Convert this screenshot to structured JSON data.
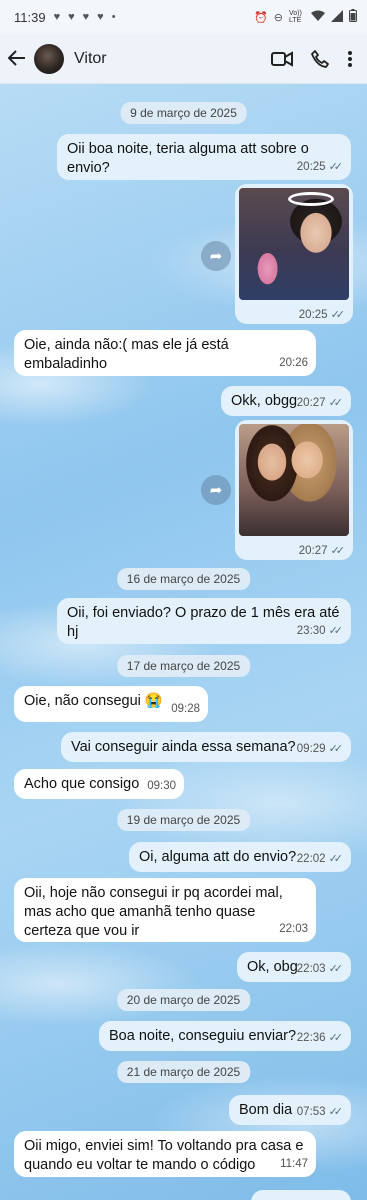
{
  "status_bar": {
    "time": "11:39",
    "notification_icons": [
      "heart-icon",
      "heart-icon",
      "heart-icon",
      "heart-icon",
      "dot-icon"
    ],
    "right_icons": [
      "alarm-icon",
      "dnd-icon",
      "volte-icon",
      "wifi-icon",
      "signal-icon",
      "battery-icon"
    ],
    "volte_label": "Vo)) LTE"
  },
  "header": {
    "contact_name": "Vitor"
  },
  "messages": [
    {
      "type": "date",
      "text": "9 de março de 2025"
    },
    {
      "type": "out",
      "text": "Oii boa noite, teria alguma att sobre o envio?",
      "time": "20:25"
    },
    {
      "type": "out-image",
      "caption": "",
      "time": "20:25"
    },
    {
      "type": "in",
      "text": "Oie, ainda não:( mas ele já está embaladinho",
      "time": "20:26"
    },
    {
      "type": "out",
      "text": "Okk, obgg",
      "time": "20:27"
    },
    {
      "type": "out-image",
      "caption": "",
      "time": "20:27"
    },
    {
      "type": "date",
      "text": "16 de março de 2025"
    },
    {
      "type": "out",
      "text": "Oii, foi enviado? O prazo de 1 mês era até hj",
      "time": "23:30"
    },
    {
      "type": "date",
      "text": "17 de março de 2025"
    },
    {
      "type": "in",
      "text": "Oie, não consegui 😭",
      "time": "09:28"
    },
    {
      "type": "out",
      "text": "Vai conseguir ainda essa semana?",
      "time": "09:29"
    },
    {
      "type": "in",
      "text": "Acho que consigo",
      "time": "09:30"
    },
    {
      "type": "date",
      "text": "19 de março de 2025"
    },
    {
      "type": "out",
      "text": "Oi, alguma att do envio?",
      "time": "22:02"
    },
    {
      "type": "in",
      "text": "Oii, hoje não consegui ir pq acordei mal, mas acho que amanhã tenho quase certeza que vou ir",
      "time": "22:03"
    },
    {
      "type": "out",
      "text": "Ok, obg",
      "time": "22:03"
    },
    {
      "type": "date",
      "text": "20 de março de 2025"
    },
    {
      "type": "out",
      "text": "Boa noite, conseguiu enviar?",
      "time": "22:36"
    },
    {
      "type": "date",
      "text": "21 de março de 2025"
    },
    {
      "type": "out",
      "text": "Bom dia",
      "time": "07:53"
    },
    {
      "type": "in",
      "text": "Oii migo, enviei sim! To voltando pra casa e quando eu voltar te mando o código",
      "time": "11:47"
    }
  ],
  "colors": {
    "outgoing_bubble": "#e2f1fb",
    "incoming_bubble": "#ffffff",
    "date_pill": "#dcebf6",
    "header_bg": "#eef3fa",
    "chat_bg": "#a9d5f3"
  }
}
